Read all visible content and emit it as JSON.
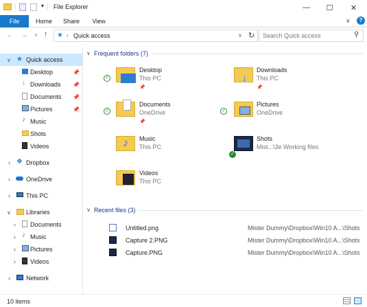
{
  "title_bar": {
    "title": "File Explorer",
    "minimize": "—",
    "maximize": "☐",
    "close": "✕"
  },
  "ribbon": {
    "tabs": [
      "File",
      "Home",
      "Share",
      "View"
    ],
    "help": "?",
    "expand": "∨"
  },
  "address": {
    "path": "Quick access",
    "search_placeholder": "Search Quick access"
  },
  "nav": {
    "items": [
      {
        "label": "Quick access",
        "selected": true
      },
      {
        "label": "Desktop",
        "pinned": true
      },
      {
        "label": "Downloads",
        "pinned": true
      },
      {
        "label": "Documents",
        "pinned": true
      },
      {
        "label": "Pictures",
        "pinned": true
      },
      {
        "label": "Music"
      },
      {
        "label": "Shots"
      },
      {
        "label": "Videos"
      },
      {
        "label": "Dropbox"
      },
      {
        "label": "OneDrive"
      },
      {
        "label": "This PC"
      },
      {
        "label": "Libraries"
      },
      {
        "label": "Documents"
      },
      {
        "label": "Music"
      },
      {
        "label": "Pictures"
      },
      {
        "label": "Videos"
      },
      {
        "label": "Network"
      }
    ]
  },
  "frequent": {
    "header": "Frequent folders (7)",
    "folders": [
      {
        "name": "Desktop",
        "location": "This PC"
      },
      {
        "name": "Downloads",
        "location": "This PC"
      },
      {
        "name": "Documents",
        "location": "OneDrive"
      },
      {
        "name": "Pictures",
        "location": "OneDrive"
      },
      {
        "name": "Music",
        "location": "This PC"
      },
      {
        "name": "Shots",
        "location": "Mist...\\3e Working files"
      },
      {
        "name": "Videos",
        "location": "This PC"
      }
    ]
  },
  "recent": {
    "header": "Recent files (3)",
    "files": [
      {
        "name": "Untitled.png",
        "path": "Mister Dummy\\Dropbox\\Win10 A...\\Shots"
      },
      {
        "name": "Capture 2.PNG",
        "path": "Mister Dummy\\Dropbox\\Win10 A...\\Shots"
      },
      {
        "name": "Capture.PNG",
        "path": "Mister Dummy\\Dropbox\\Win10 A...\\Shots"
      }
    ]
  },
  "status": {
    "count": "10 items"
  },
  "colors": {
    "accent": "#1979ca",
    "selected": "#cce8ff",
    "folder": "#f5c955",
    "header": "#1e3287"
  }
}
